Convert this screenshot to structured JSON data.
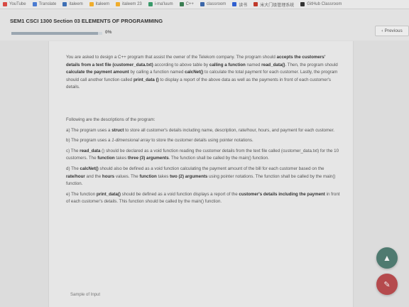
{
  "bookmarks": [
    {
      "label": "YouTube",
      "icon": "youtube-icon",
      "color": "#d84a43"
    },
    {
      "label": "Translate",
      "icon": "translate-icon",
      "color": "#4a7bd1"
    },
    {
      "label": "italeem",
      "icon": "italeem-icon",
      "color": "#3d6fb5"
    },
    {
      "label": "italeem",
      "icon": "italeem-icon",
      "color": "#f0ad2c"
    },
    {
      "label": "italeem 23",
      "icon": "italeem-icon",
      "color": "#f0ad2c"
    },
    {
      "label": "i-ma'luum",
      "icon": "imaluum-icon",
      "color": "#3a9a6a"
    },
    {
      "label": "C++",
      "icon": "cpp-icon",
      "color": "#3b7d52"
    },
    {
      "label": "classroom",
      "icon": "classroom-icon",
      "color": "#3b66a8"
    },
    {
      "label": "读书",
      "icon": "reading-icon",
      "color": "#2f5fd0"
    },
    {
      "label": "米大门级管理系统",
      "icon": "mail-icon",
      "color": "#c0392b"
    },
    {
      "label": "GitHub Classroom",
      "icon": "github-icon",
      "color": "#333333"
    }
  ],
  "header": {
    "course_title": "SEM1 CSCI 1300 Section 03 ELEMENTS OF PROGRAMMING",
    "progress_text": "0%",
    "progress_fraction": 0.95,
    "previous_label": "Previous"
  },
  "content": {
    "p1_a": "You are asked to design a C++ program that assist the owner of the Telekom company. The program should ",
    "p1_b": "accepts the customers' details from a text file (customer_data.txt)",
    "p1_c": " according to above table by ",
    "p1_d": "calling a function",
    "p1_e": " named ",
    "p1_f": "read_data()",
    "p1_g": ". Then, the program should ",
    "p1_h": "calculate the payment amount",
    "p1_i": " by calling a function named ",
    "p1_j": "calcNet()",
    "p1_k": " to calculate the total payment for each customer. Lastly, the program should call another function called ",
    "p1_l": "print_data ()",
    "p1_m": " to display a report of the above data as well as the payments in front of each customer's details.",
    "intro": "Following are the descriptions of the program:",
    "a_1": "a)   The program uses a ",
    "a_2": "struct",
    "a_3": " to store all customer's details including name, description, rate/hour, hours, and payment for each customer.",
    "b_1": "b)   The program uses a ",
    "b_2": "1-dimensional array",
    "b_3": " to store the customer details using pointer notations.",
    "c_1": "c)   The ",
    "c_2": "read_data",
    "c_3": " () should be declared as a void function reading the customer details from the text file called (customer_data.txt) for the 10 customers. The ",
    "c_4": "function",
    "c_5": " takes ",
    "c_6": "three (3) arguments",
    "c_7": ". The function shall be called by the main() function.",
    "d_1": "d)   The ",
    "d_2": "calcNet()",
    "d_3": " should also be defined as a void function calculating the payment amount of the bill for each customer based on the ",
    "d_4": "rate/hour",
    "d_5": " and the ",
    "d_6": "hours",
    "d_7": " values. The ",
    "d_8": "function",
    "d_9": " takes ",
    "d_10": "two (2) arguments",
    "d_11": " using pointer notations. The function shall be called by the main() function.",
    "e_1": "e)   The function ",
    "e_2": "print_data()",
    "e_3": " should be defined as a void function displays a report of the ",
    "e_4": "customer's details including the payment",
    "e_5": " in front of each customer's details. This function should be called by the main() function.",
    "sample": "Sample of Input"
  },
  "fab": {
    "up_icon": "arrow-up-icon",
    "edit_icon": "pencil-icon"
  }
}
